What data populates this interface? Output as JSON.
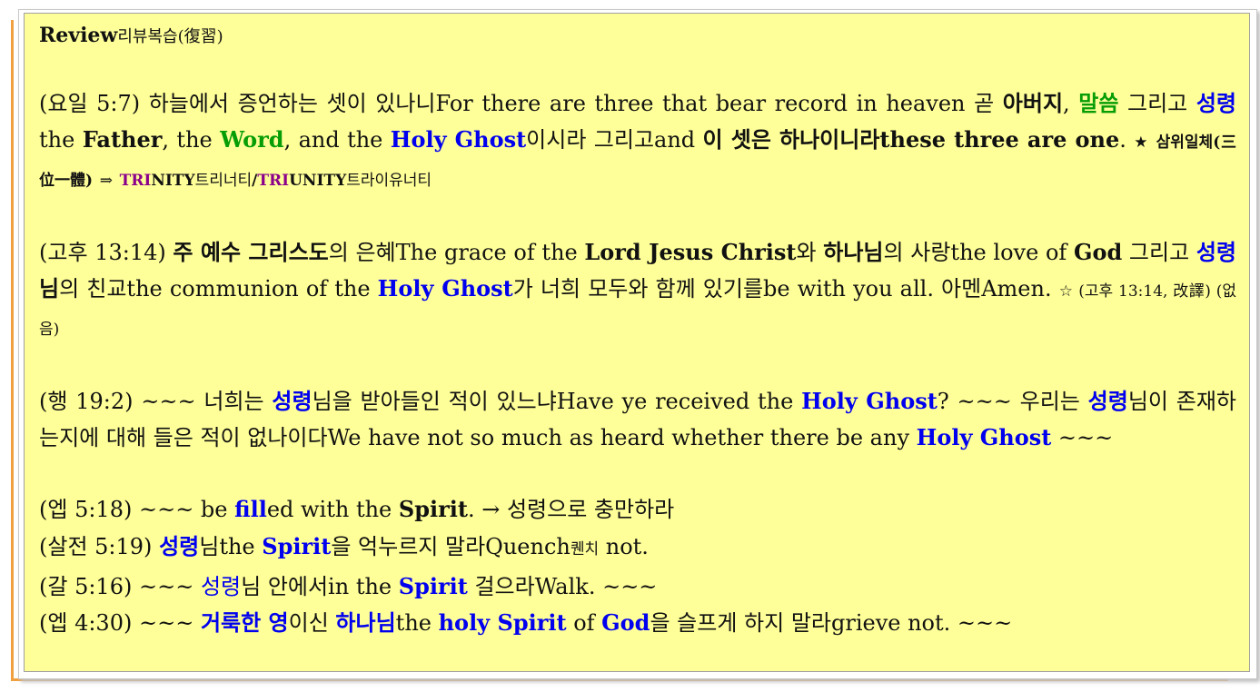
{
  "title": {
    "en": "Review",
    "ko": "리뷰복습(復習)"
  },
  "p1": {
    "ref": "(요일 5:7)",
    "t1": " 하늘에서 증언하는 셋이 있나니For there are three that bear record in heaven 곧 ",
    "father_ko": "아버지",
    "t2": ", ",
    "word_ko": "말씀",
    "t3": " 그리고 ",
    "spirit_ko": "성령",
    "t4": "the ",
    "father_en": "Father",
    "t5": ", the ",
    "word_en": "Word",
    "t6": ", and the ",
    "holy_ghost": "Holy Ghost",
    "t7": "이시라 그리고and ",
    "three_one_ko": "이 셋은 하나이니라",
    "three_one_en": "these three are one",
    "t8": ". ",
    "star": "★",
    "trinity_ko": "삼위일체",
    "trinity_hanja": "(三位一體)",
    "arrow": "⇒",
    "tri1": "TRI",
    "nity": "NITY",
    "trinity_read": "트리너티",
    "slash": "/",
    "tri2": "TRI",
    "unity": "UNITY",
    "triunity_read": "트라이유너티"
  },
  "p2": {
    "ref": "(고후 13:14)",
    "lord_ko": "주 예수 그리스도",
    "t1": "의 은혜The grace of the ",
    "lord_en": "Lord Jesus Christ",
    "t2": "와 ",
    "god_ko": "하나님",
    "t3": "의 사랑the love of ",
    "god_en": "God",
    "t4": " 그리고 ",
    "spirit_ko": "성령",
    "nim": "님",
    "t5": "의 친교the communion of the ",
    "holy_ghost": "Holy Ghost",
    "t6": "가 너희 모두와 함께 있기를be with you all. 아멘Amen. ",
    "note": "☆ (고후 13:14, 改譯) (없 음)"
  },
  "p3": {
    "ref": "(행 19:2)",
    "t1": " ~~~ 너희는 ",
    "spirit1": "성령",
    "t2": "님을 받아들인 적이 있느냐Have ye received the ",
    "holy_ghost1": "Holy Ghost",
    "t3": "? ~~~ 우리는 ",
    "spirit2": "성령",
    "t4": "님이 존재하는지에 대해 들은 적이 없나이다We have not so much as heard whether there be any ",
    "holy_ghost2": "Holy Ghost",
    "t5": " ~~~"
  },
  "l1": {
    "ref": "(엡 5:18)",
    "t1": " ~~~ be ",
    "fill": "fill",
    "t2": "ed with the ",
    "spirit": "Spirit",
    "t3": ". → 성령으로 충만하라"
  },
  "l2": {
    "ref": "(살전 5:19)",
    "spirit_ko": "성령",
    "t1": "님the ",
    "spirit_en": "Spirit",
    "t2": "을 억누르지 말라Quench",
    "quench_ko": "퀜치",
    "t3": " not."
  },
  "l3": {
    "ref": "(갈 5:16)",
    "t1": " ~~~ ",
    "spirit_ko": "성령",
    "t2": "님 안에서in the ",
    "spirit_en": "Spirit",
    "t3": " 걸으라Walk. ~~~"
  },
  "l4": {
    "ref": "(엡 4:30)",
    "t1": " ~~~ ",
    "holy_ko": "거룩한 영",
    "t2": "이신 ",
    "god_ko": "하나님",
    "t3": "the ",
    "holy_spirit": "holy Spirit",
    "t4": " of ",
    "god_en": "God",
    "t5": "을 슬프게 하지 말라grieve not. ~~~"
  }
}
